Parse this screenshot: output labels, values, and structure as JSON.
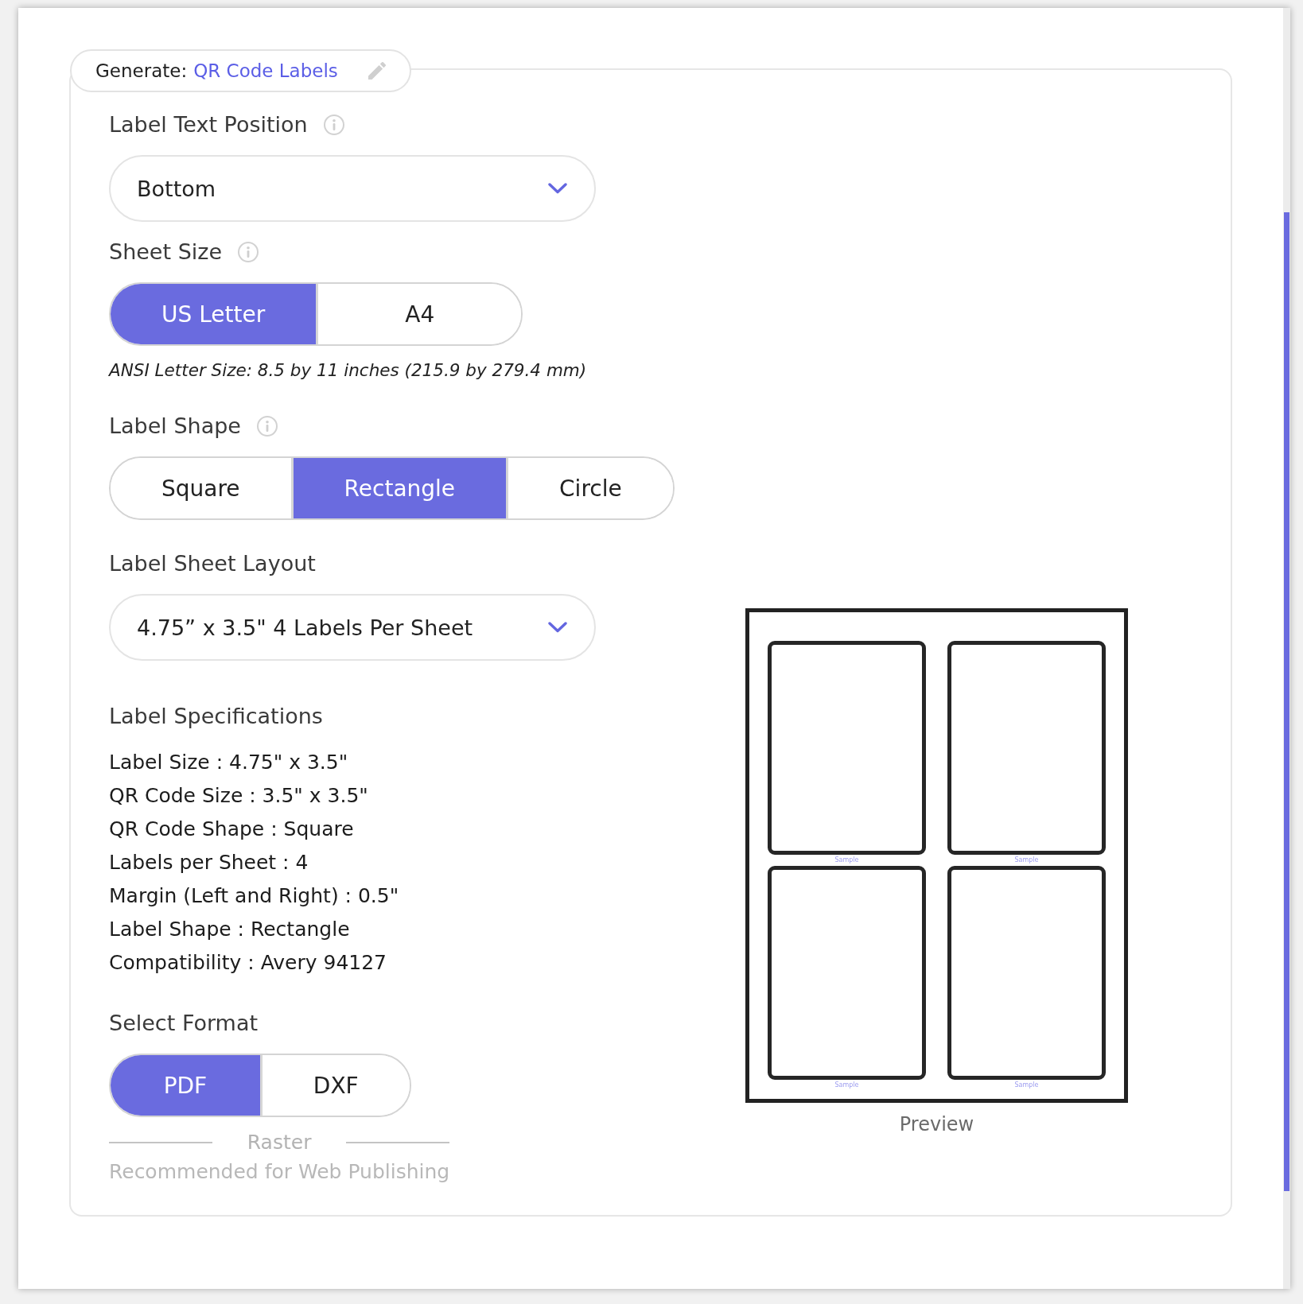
{
  "legend": {
    "prefix": "Generate:",
    "title": "QR Code Labels"
  },
  "fields": [
    {
      "kind": "dropdown",
      "label": "Label Text Position",
      "info": true,
      "value": "Bottom"
    },
    {
      "kind": "segmented",
      "label": "Sheet Size",
      "info": true,
      "options": [
        {
          "label": "US Letter",
          "selected": true
        },
        {
          "label": "A4",
          "selected": false
        }
      ],
      "note": "ANSI Letter Size: 8.5 by 11 inches (215.9 by 279.4 mm)"
    },
    {
      "kind": "segmented",
      "label": "Label Shape",
      "info": true,
      "options": [
        {
          "label": "Square",
          "selected": false
        },
        {
          "label": "Rectangle",
          "selected": true
        },
        {
          "label": "Circle",
          "selected": false
        }
      ]
    },
    {
      "kind": "dropdown",
      "label": "Label Sheet Layout",
      "info": false,
      "value": "4.75” x 3.5\" 4 Labels Per Sheet"
    },
    {
      "kind": "specs",
      "label": "Label Specifications",
      "info": false,
      "lines": [
        "Label Size : 4.75\" x 3.5\"",
        "QR Code Size : 3.5\" x 3.5\"",
        "QR Code Shape : Square",
        "Labels per Sheet : 4",
        "Margin (Left and Right) : 0.5\"",
        "Label Shape : Rectangle",
        "Compatibility : Avery 94127"
      ]
    },
    {
      "kind": "segmented",
      "label": "Select Format",
      "info": false,
      "options": [
        {
          "label": "PDF",
          "selected": true
        },
        {
          "label": "DXF",
          "selected": false
        }
      ]
    }
  ],
  "format_group": {
    "heading": "Raster",
    "hint": "Recommended for Web Publishing"
  },
  "preview": {
    "labels": [
      {
        "caption": "Sample"
      },
      {
        "caption": "Sample"
      },
      {
        "caption": "Sample"
      },
      {
        "caption": "Sample"
      }
    ],
    "caption": "Preview"
  }
}
